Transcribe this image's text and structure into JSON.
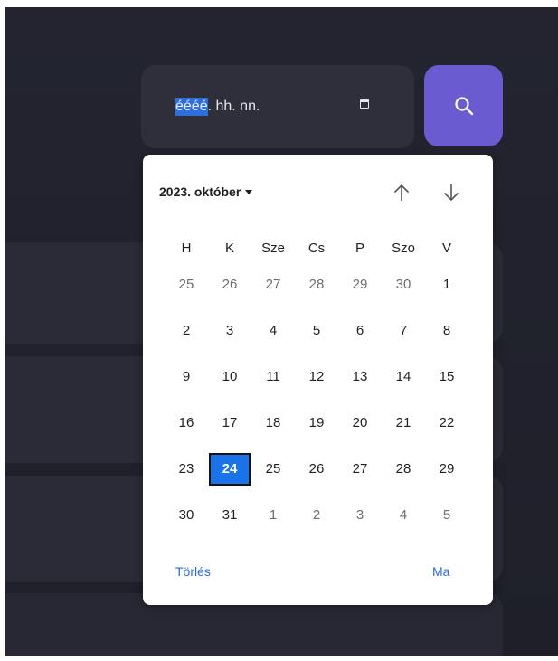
{
  "date_input": {
    "year_placeholder": "éééé",
    "rest_placeholder": ". hh. nn."
  },
  "search_button": {
    "icon": "search-icon"
  },
  "calendar": {
    "month_label": "2023. október",
    "weekdays": [
      "H",
      "K",
      "Sze",
      "Cs",
      "P",
      "Szo",
      "V"
    ],
    "weeks": [
      [
        {
          "d": "25",
          "m": true
        },
        {
          "d": "26",
          "m": true
        },
        {
          "d": "27",
          "m": true
        },
        {
          "d": "28",
          "m": true
        },
        {
          "d": "29",
          "m": true
        },
        {
          "d": "30",
          "m": true
        },
        {
          "d": "1",
          "m": false
        }
      ],
      [
        {
          "d": "2",
          "m": false
        },
        {
          "d": "3",
          "m": false
        },
        {
          "d": "4",
          "m": false
        },
        {
          "d": "5",
          "m": false
        },
        {
          "d": "6",
          "m": false
        },
        {
          "d": "7",
          "m": false
        },
        {
          "d": "8",
          "m": false
        }
      ],
      [
        {
          "d": "9",
          "m": false
        },
        {
          "d": "10",
          "m": false
        },
        {
          "d": "11",
          "m": false
        },
        {
          "d": "12",
          "m": false
        },
        {
          "d": "13",
          "m": false
        },
        {
          "d": "14",
          "m": false
        },
        {
          "d": "15",
          "m": false
        }
      ],
      [
        {
          "d": "16",
          "m": false
        },
        {
          "d": "17",
          "m": false
        },
        {
          "d": "18",
          "m": false
        },
        {
          "d": "19",
          "m": false
        },
        {
          "d": "20",
          "m": false
        },
        {
          "d": "21",
          "m": false
        },
        {
          "d": "22",
          "m": false
        }
      ],
      [
        {
          "d": "23",
          "m": false
        },
        {
          "d": "24",
          "m": false,
          "sel": true
        },
        {
          "d": "25",
          "m": false
        },
        {
          "d": "26",
          "m": false
        },
        {
          "d": "27",
          "m": false
        },
        {
          "d": "28",
          "m": false
        },
        {
          "d": "29",
          "m": false
        }
      ],
      [
        {
          "d": "30",
          "m": false
        },
        {
          "d": "31",
          "m": false
        },
        {
          "d": "1",
          "m": true
        },
        {
          "d": "2",
          "m": true
        },
        {
          "d": "3",
          "m": true
        },
        {
          "d": "4",
          "m": true
        },
        {
          "d": "5",
          "m": true
        }
      ]
    ],
    "clear_label": "Törlés",
    "today_label": "Ma"
  },
  "colors": {
    "accent": "#6b5bd0",
    "selected_day": "#1a73e8",
    "link": "#2b6ad8",
    "background": "#232430"
  }
}
